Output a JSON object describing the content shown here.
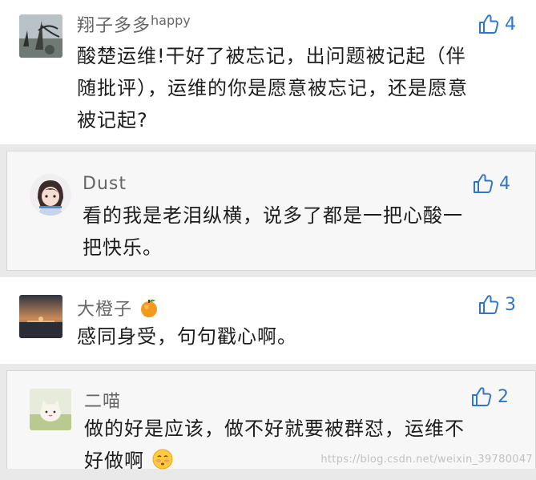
{
  "comments": [
    {
      "username": "翔子多多",
      "username_suffix": "happy",
      "text_lines": [
        "酸楚运维!干好了被忘记，出问题被记起（伴",
        "随批评），运维的你是愿意被忘记，还是愿意",
        "被记起?"
      ],
      "likes": "4",
      "avatar_icon": "landscape-avatar-icon"
    },
    {
      "username": "Dust",
      "text_lines": [
        "看的我是老泪纵横，说多了都是一把心酸一",
        "把快乐。"
      ],
      "likes": "4",
      "avatar_icon": "anime-girl-avatar-icon"
    },
    {
      "username": "大橙子",
      "username_emoji": "orange-emoji-icon",
      "text_lines": [
        "感同身受，句句戳心啊。"
      ],
      "likes": "3",
      "avatar_icon": "sunset-avatar-icon"
    },
    {
      "username": "二喵",
      "text_lines": [
        "做的好是应该，做不好就要被群怼，运维不",
        "好做啊"
      ],
      "text_emoji": "blushing-face-emoji-icon",
      "likes": "2",
      "avatar_icon": "cat-avatar-icon"
    }
  ],
  "watermark": "https://blog.csdn.net/weixin_39780047",
  "colors": {
    "like_blue": "#2f77c9",
    "background": "#e9e9e9"
  }
}
